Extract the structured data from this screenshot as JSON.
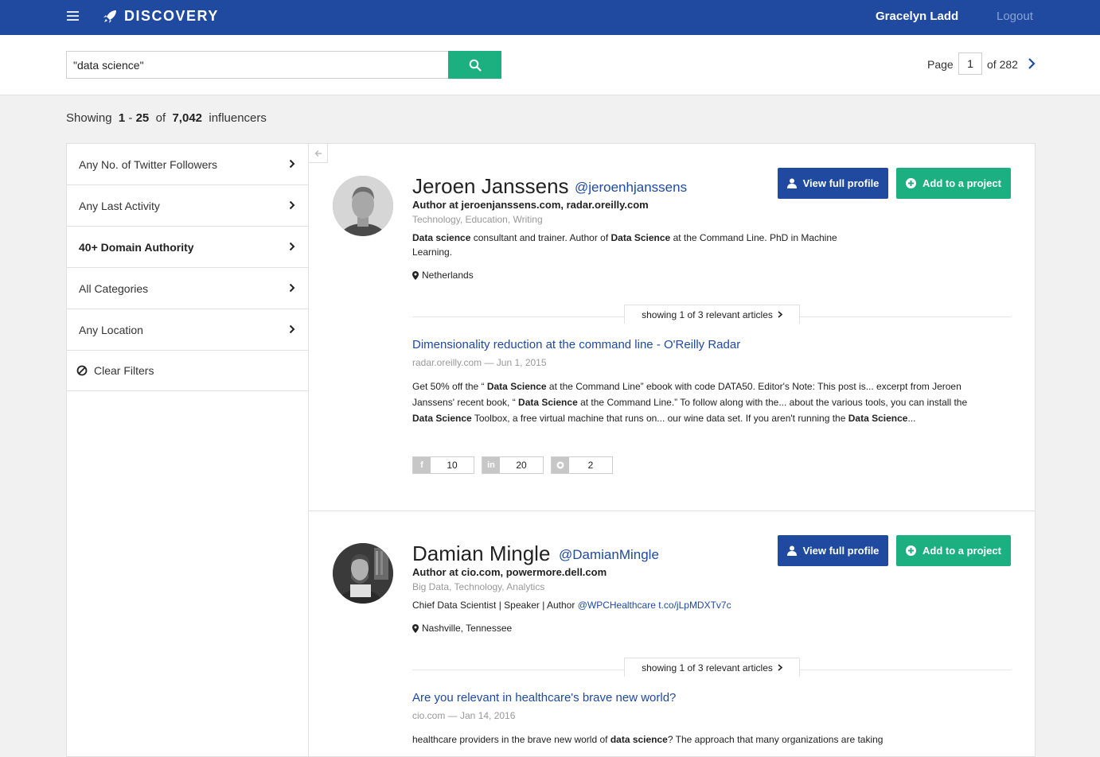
{
  "header": {
    "brand": "DISCOVERY",
    "user_name": "Gracelyn Ladd",
    "logout": "Logout",
    "brand_color": "#1f4aa0"
  },
  "search": {
    "value": "\"data science\"",
    "button_icon": "search-icon",
    "button_color": "#1cb080"
  },
  "pagination": {
    "page_label": "Page",
    "current_page": "1",
    "of_label": "of 282"
  },
  "summary": {
    "prefix": "Showing",
    "range_start": "1",
    "range_sep": "-",
    "range_end": "25",
    "of": "of",
    "total": "7,042",
    "suffix": "influencers"
  },
  "filters": [
    {
      "label": "Any No. of Twitter Followers"
    },
    {
      "label": "Any Last Activity"
    },
    {
      "label": "40+ Domain Authority"
    },
    {
      "label": "All Categories"
    },
    {
      "label": "Any Location"
    }
  ],
  "clear_filters": "Clear Filters",
  "results": [
    {
      "name": "Jeroen Janssens",
      "handle": "@jeroenhjanssens",
      "author": "Author at jeroenjanssens.com, radar.oreilly.com",
      "categories": "Technology, Education, Writing",
      "bio_parts": [
        "Data science",
        " consultant and trainer. Author of ",
        "Data Science",
        " at the Command Line. PhD in Machine Learning."
      ],
      "location": "Netherlands",
      "view_profile": "View full profile",
      "add_project": "Add to a project",
      "articles_label": "showing 1 of 3 relevant articles",
      "article": {
        "title": "Dimensionality reduction at the command line - O'Reilly Radar",
        "meta": "radar.oreilly.com — Jun 1, 2015",
        "body_parts": [
          "Get 50% off the “ ",
          "Data Science",
          " at the Command Line” ebook with code DATA50. Editor's Note: This post is... excerpt from Jeroen Janssens' recent book, “ ",
          "Data Science",
          " at the Command Line.” To follow along with the... about the various tools, you can install the ",
          "Data Science",
          " Toolbox, a free virtual machine that runs on... our wine data set. If you aren't running the ",
          "Data Science",
          "..."
        ],
        "shares": {
          "facebook": "10",
          "linkedin": "20",
          "pinterest": "2"
        }
      }
    },
    {
      "name": "Damian Mingle",
      "handle": "@DamianMingle",
      "author": "Author at cio.com, powermore.dell.com",
      "categories": "Big Data, Technology, Analytics",
      "bio_text": "Chief Data Scientist | Speaker | Author ",
      "bio_link1": "@WPCHealthcare",
      "bio_link2": "t.co/jLpMDXTv7c",
      "location": "Nashville, Tennessee",
      "view_profile": "View full profile",
      "add_project": "Add to a project",
      "articles_label": "showing 1 of 3 relevant articles",
      "article": {
        "title": "Are you relevant in healthcare's brave new world?",
        "meta": "cio.com — Jan 14, 2016",
        "body_parts": [
          "healthcare providers in the brave new world of ",
          "data science",
          "? The approach that many organizations are taking"
        ]
      }
    }
  ]
}
